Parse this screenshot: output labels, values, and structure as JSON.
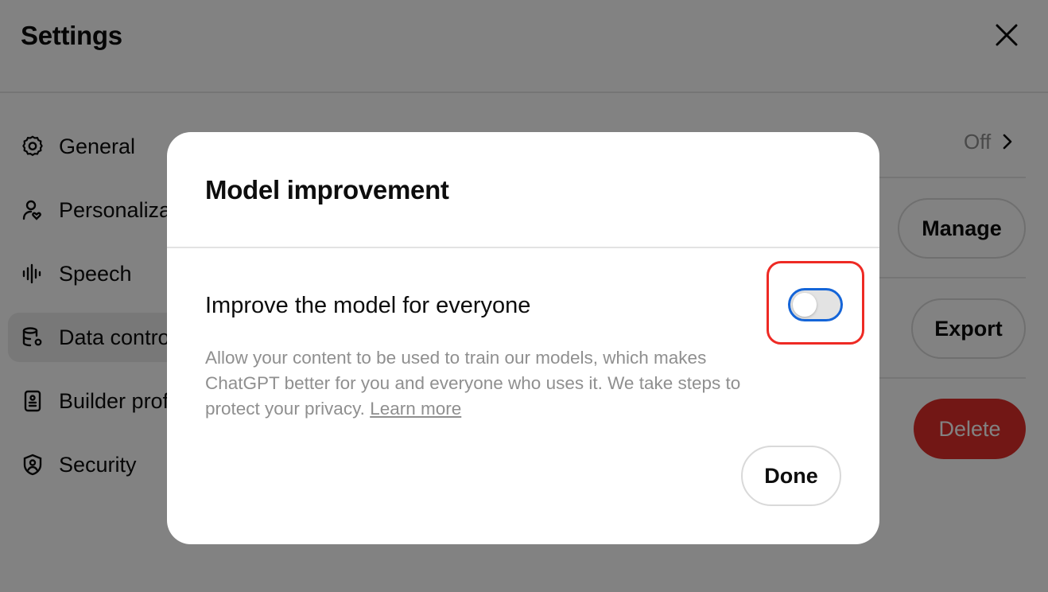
{
  "settings": {
    "title": "Settings",
    "nav": [
      {
        "label": "General",
        "icon": "gear-icon"
      },
      {
        "label": "Personalization",
        "icon": "person-heart-icon"
      },
      {
        "label": "Speech",
        "icon": "waveform-icon"
      },
      {
        "label": "Data controls",
        "icon": "database-gear-icon",
        "active": true
      },
      {
        "label": "Builder profile",
        "icon": "id-badge-icon"
      },
      {
        "label": "Security",
        "icon": "shield-user-icon"
      }
    ],
    "panel": {
      "model_improvement_value": "Off",
      "manage_label": "Manage",
      "export_label": "Export",
      "delete_label": "Delete"
    }
  },
  "modal": {
    "title": "Model improvement",
    "option_label": "Improve the model for everyone",
    "toggle_on": false,
    "description": "Allow your content to be used to train our models, which makes ChatGPT better for you and everyone who uses it. We take steps to protect your privacy.",
    "learn_more": "Learn more",
    "done_label": "Done"
  },
  "colors": {
    "toggle_border": "#1565d8",
    "highlight": "#ee2a24",
    "delete_bg": "#e02e2a"
  }
}
